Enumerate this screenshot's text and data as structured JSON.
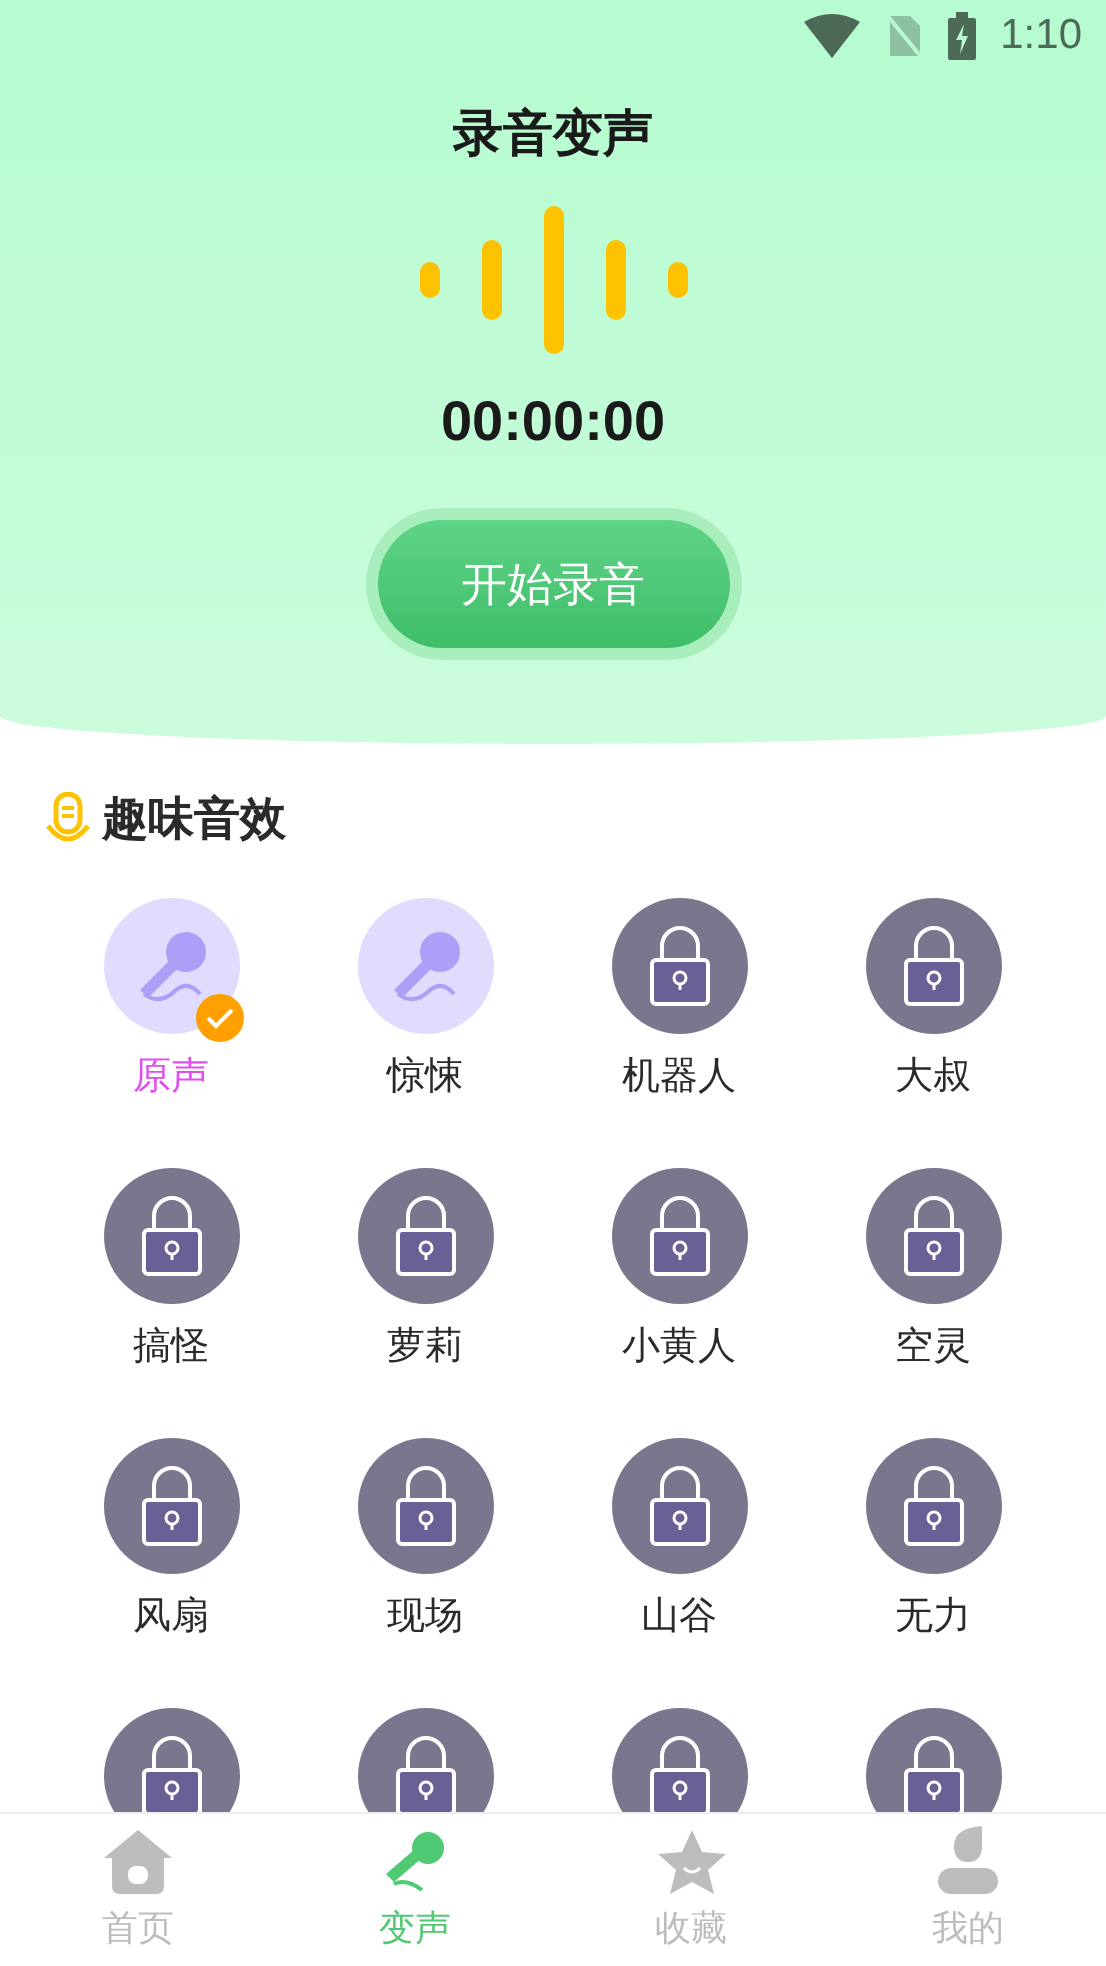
{
  "status_bar": {
    "time": "1:10"
  },
  "header": {
    "title": "录音变声",
    "timer": "00:00:00",
    "record_button": "开始录音"
  },
  "section": {
    "title": "趣味音效"
  },
  "effects": [
    {
      "label": "原声",
      "kind": "mic",
      "selected": true
    },
    {
      "label": "惊悚",
      "kind": "mic",
      "selected": false
    },
    {
      "label": "机器人",
      "kind": "lock",
      "selected": false
    },
    {
      "label": "大叔",
      "kind": "lock",
      "selected": false
    },
    {
      "label": "搞怪",
      "kind": "lock",
      "selected": false
    },
    {
      "label": "萝莉",
      "kind": "lock",
      "selected": false
    },
    {
      "label": "小黄人",
      "kind": "lock",
      "selected": false
    },
    {
      "label": "空灵",
      "kind": "lock",
      "selected": false
    },
    {
      "label": "风扇",
      "kind": "lock",
      "selected": false
    },
    {
      "label": "现场",
      "kind": "lock",
      "selected": false
    },
    {
      "label": "山谷",
      "kind": "lock",
      "selected": false
    },
    {
      "label": "无力",
      "kind": "lock",
      "selected": false
    },
    {
      "kind": "lock",
      "selected": false
    },
    {
      "kind": "lock",
      "selected": false
    },
    {
      "kind": "lock",
      "selected": false
    },
    {
      "kind": "lock",
      "selected": false
    }
  ],
  "tabs": [
    {
      "label": "首页",
      "kind": "home",
      "selected": false
    },
    {
      "label": "变声",
      "kind": "mic",
      "selected": true
    },
    {
      "label": "收藏",
      "kind": "star",
      "selected": false
    },
    {
      "label": "我的",
      "kind": "user",
      "selected": false
    }
  ]
}
